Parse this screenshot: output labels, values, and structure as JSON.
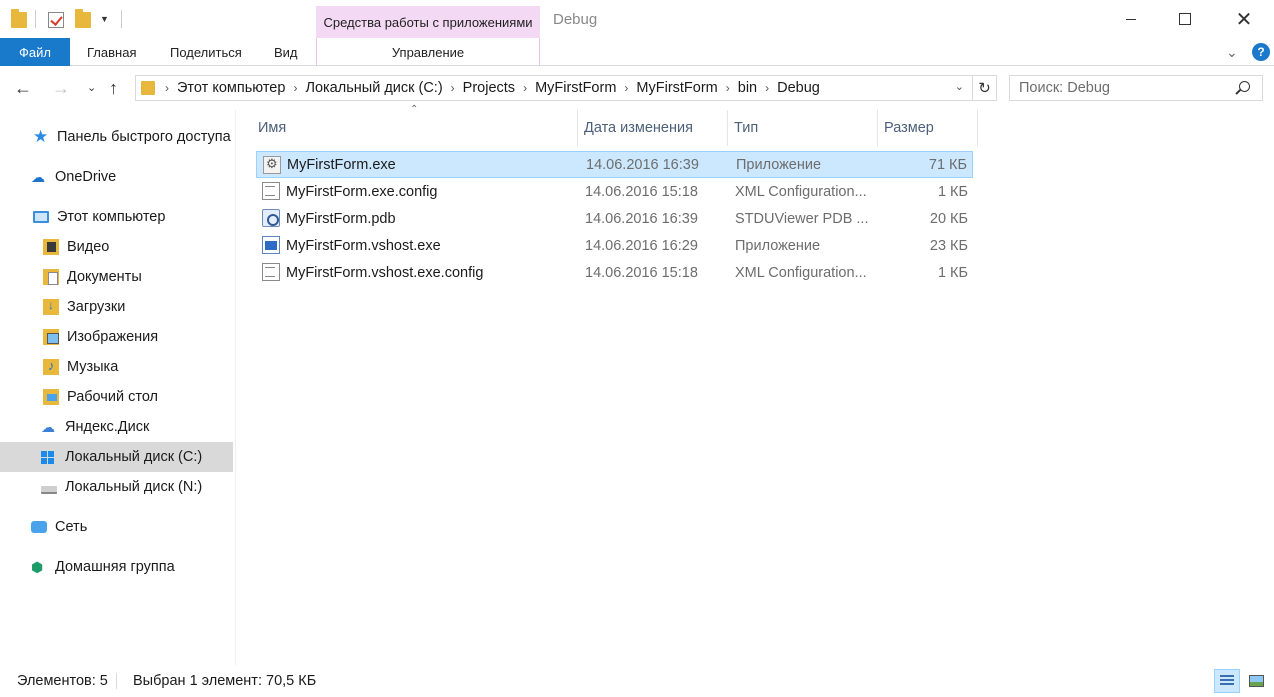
{
  "window": {
    "title": "Debug",
    "context_tab_group": "Средства работы с приложениями"
  },
  "ribbon": {
    "file_tab": "Файл",
    "tabs": [
      "Главная",
      "Поделиться",
      "Вид"
    ],
    "context_tab": "Управление",
    "help": "?"
  },
  "address": {
    "crumbs": [
      "Этот компьютер",
      "Локальный диск (C:)",
      "Projects",
      "MyFirstForm",
      "MyFirstForm",
      "bin",
      "Debug"
    ]
  },
  "search": {
    "placeholder": "Поиск: Debug"
  },
  "nav": {
    "items": [
      {
        "label": "Панель быстрого доступа",
        "icon": "star-icon"
      },
      {
        "label": "OneDrive",
        "icon": "cloud-icon"
      },
      {
        "label": "Этот компьютер",
        "icon": "computer-icon"
      },
      {
        "label": "Видео",
        "icon": "video-folder-icon"
      },
      {
        "label": "Документы",
        "icon": "documents-folder-icon"
      },
      {
        "label": "Загрузки",
        "icon": "downloads-folder-icon"
      },
      {
        "label": "Изображения",
        "icon": "pictures-folder-icon"
      },
      {
        "label": "Музыка",
        "icon": "music-folder-icon"
      },
      {
        "label": "Рабочий стол",
        "icon": "desktop-folder-icon"
      },
      {
        "label": "Яндекс.Диск",
        "icon": "yandex-disk-icon"
      },
      {
        "label": "Локальный диск (C:)",
        "icon": "system-drive-icon"
      },
      {
        "label": "Локальный диск (N:)",
        "icon": "drive-icon"
      },
      {
        "label": "Сеть",
        "icon": "network-icon"
      },
      {
        "label": "Домашняя группа",
        "icon": "homegroup-icon"
      }
    ]
  },
  "columns": {
    "name": "Имя",
    "date": "Дата изменения",
    "type": "Тип",
    "size": "Размер"
  },
  "files": [
    {
      "name": "MyFirstForm.exe",
      "date": "14.06.2016 16:39",
      "type": "Приложение",
      "size": "71 КБ",
      "icon": "exe-icon"
    },
    {
      "name": "MyFirstForm.exe.config",
      "date": "14.06.2016 15:18",
      "type": "XML Configuration...",
      "size": "1 КБ",
      "icon": "config-file-icon"
    },
    {
      "name": "MyFirstForm.pdb",
      "date": "14.06.2016 16:39",
      "type": "STDUViewer PDB ...",
      "size": "20 КБ",
      "icon": "pdb-file-icon"
    },
    {
      "name": "MyFirstForm.vshost.exe",
      "date": "14.06.2016 16:29",
      "type": "Приложение",
      "size": "23 КБ",
      "icon": "vshost-exe-icon"
    },
    {
      "name": "MyFirstForm.vshost.exe.config",
      "date": "14.06.2016 15:18",
      "type": "XML Configuration...",
      "size": "1 КБ",
      "icon": "config-file-icon"
    }
  ],
  "status": {
    "count": "Элементов: 5",
    "selection": "Выбран 1 элемент: 70,5 КБ"
  },
  "colors": {
    "accent": "#1979ca",
    "selection_bg": "#cce8ff",
    "context_tab": "#f4d9f4"
  }
}
